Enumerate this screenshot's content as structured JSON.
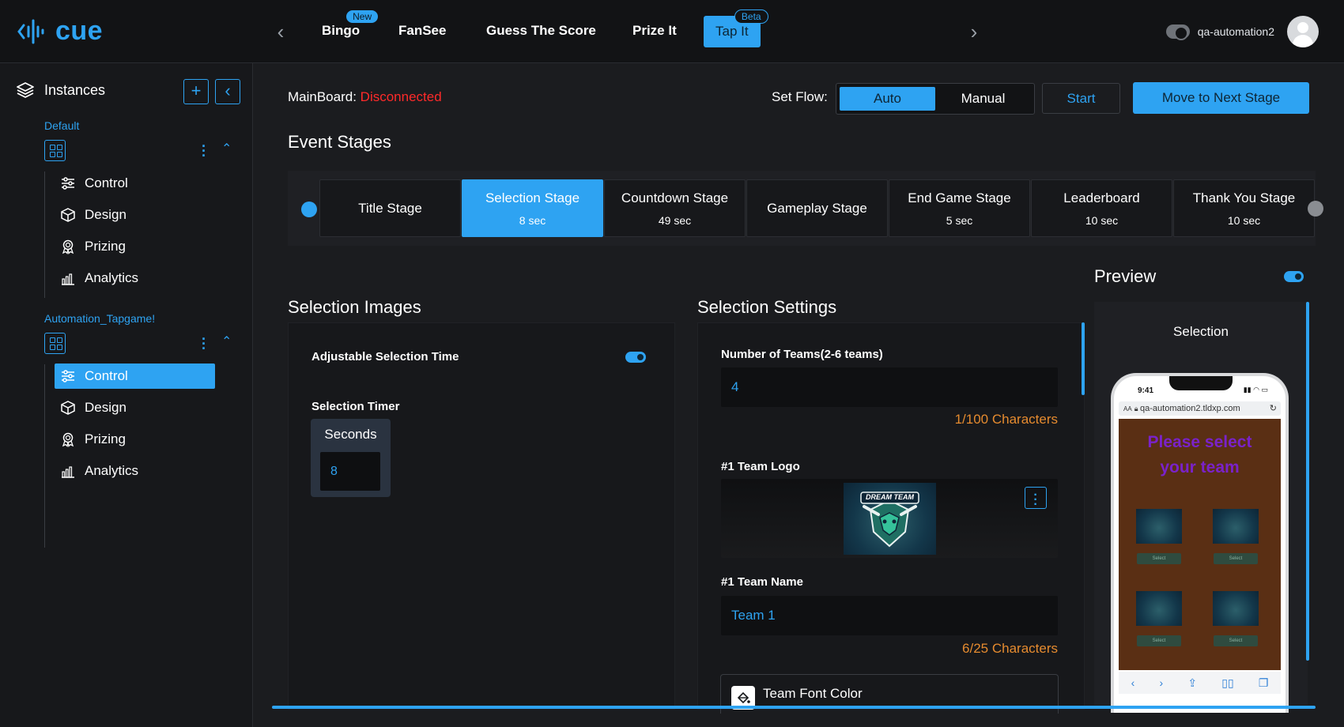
{
  "app": {
    "logo_text": "cue"
  },
  "topnav": {
    "tabs": [
      {
        "label": "Bingo",
        "badge": "New"
      },
      {
        "label": "FanSee"
      },
      {
        "label": "Guess The Score"
      },
      {
        "label": "Prize It"
      },
      {
        "label": "Tap It",
        "badge": "Beta",
        "active": true
      }
    ],
    "username": "qa-automation2"
  },
  "sidebar": {
    "title": "Instances",
    "instances": [
      {
        "name": "Default",
        "menu": [
          "Control",
          "Design",
          "Prizing",
          "Analytics"
        ]
      },
      {
        "name": "Automation_Tapgame!",
        "menu": [
          "Control",
          "Design",
          "Prizing",
          "Analytics"
        ],
        "active_item": "Control"
      }
    ]
  },
  "status": {
    "mainboard_label": "MainBoard:",
    "mainboard_value": "Disconnected",
    "set_flow_label": "Set Flow:",
    "flow_options": [
      "Auto",
      "Manual"
    ],
    "flow_selected": "Auto",
    "start_label": "Start",
    "next_label": "Move to Next Stage"
  },
  "event_stages": {
    "title": "Event Stages",
    "stages": [
      {
        "name": "Title Stage",
        "time": ""
      },
      {
        "name": "Selection Stage",
        "time": "8 sec",
        "active": true
      },
      {
        "name": "Countdown Stage",
        "time": "49 sec"
      },
      {
        "name": "Gameplay Stage",
        "time": ""
      },
      {
        "name": "End Game Stage",
        "time": "5 sec"
      },
      {
        "name": "Leaderboard",
        "time": "10 sec"
      },
      {
        "name": "Thank You Stage",
        "time": "10 sec"
      }
    ]
  },
  "selection_images": {
    "title": "Selection Images",
    "adjustable_label": "Adjustable Selection Time",
    "adjustable_on": true,
    "timer_label": "Selection Timer",
    "seconds_label": "Seconds",
    "seconds_value": "8"
  },
  "selection_settings": {
    "title": "Selection Settings",
    "teams_label": "Number of Teams(2-6 teams)",
    "teams_value": "4",
    "teams_count": "1/100 Characters",
    "logo_label": "#1 Team Logo",
    "logo_image_text": "DREAM TEAM",
    "name_label": "#1 Team Name",
    "name_value": "Team 1",
    "name_count": "6/25 Characters",
    "font_color_label": "Team Font Color"
  },
  "preview": {
    "title": "Preview",
    "enabled": true,
    "screen_label": "Selection",
    "phone_time": "9:41",
    "phone_url": "qa-automation2.tldxp.com",
    "phone_url_prefix": "AA",
    "prompt": "Please select your team",
    "select_label": "Select"
  },
  "colors": {
    "accent": "#2ea3f2",
    "warning": "#e68b2f",
    "error": "#ff2a2a",
    "background": "#1b1c1f"
  }
}
